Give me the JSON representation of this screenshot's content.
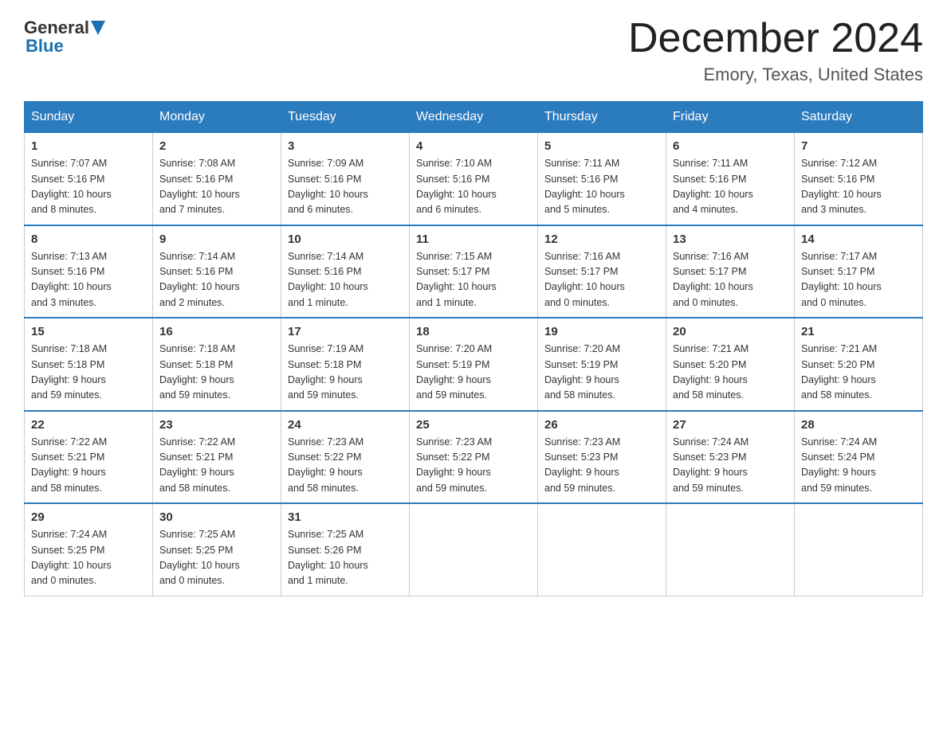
{
  "header": {
    "logo_general": "General",
    "logo_blue": "Blue",
    "month_year": "December 2024",
    "location": "Emory, Texas, United States"
  },
  "days_of_week": [
    "Sunday",
    "Monday",
    "Tuesday",
    "Wednesday",
    "Thursday",
    "Friday",
    "Saturday"
  ],
  "weeks": [
    [
      {
        "num": "1",
        "sunrise": "7:07 AM",
        "sunset": "5:16 PM",
        "daylight": "10 hours and 8 minutes."
      },
      {
        "num": "2",
        "sunrise": "7:08 AM",
        "sunset": "5:16 PM",
        "daylight": "10 hours and 7 minutes."
      },
      {
        "num": "3",
        "sunrise": "7:09 AM",
        "sunset": "5:16 PM",
        "daylight": "10 hours and 6 minutes."
      },
      {
        "num": "4",
        "sunrise": "7:10 AM",
        "sunset": "5:16 PM",
        "daylight": "10 hours and 6 minutes."
      },
      {
        "num": "5",
        "sunrise": "7:11 AM",
        "sunset": "5:16 PM",
        "daylight": "10 hours and 5 minutes."
      },
      {
        "num": "6",
        "sunrise": "7:11 AM",
        "sunset": "5:16 PM",
        "daylight": "10 hours and 4 minutes."
      },
      {
        "num": "7",
        "sunrise": "7:12 AM",
        "sunset": "5:16 PM",
        "daylight": "10 hours and 3 minutes."
      }
    ],
    [
      {
        "num": "8",
        "sunrise": "7:13 AM",
        "sunset": "5:16 PM",
        "daylight": "10 hours and 3 minutes."
      },
      {
        "num": "9",
        "sunrise": "7:14 AM",
        "sunset": "5:16 PM",
        "daylight": "10 hours and 2 minutes."
      },
      {
        "num": "10",
        "sunrise": "7:14 AM",
        "sunset": "5:16 PM",
        "daylight": "10 hours and 1 minute."
      },
      {
        "num": "11",
        "sunrise": "7:15 AM",
        "sunset": "5:17 PM",
        "daylight": "10 hours and 1 minute."
      },
      {
        "num": "12",
        "sunrise": "7:16 AM",
        "sunset": "5:17 PM",
        "daylight": "10 hours and 0 minutes."
      },
      {
        "num": "13",
        "sunrise": "7:16 AM",
        "sunset": "5:17 PM",
        "daylight": "10 hours and 0 minutes."
      },
      {
        "num": "14",
        "sunrise": "7:17 AM",
        "sunset": "5:17 PM",
        "daylight": "10 hours and 0 minutes."
      }
    ],
    [
      {
        "num": "15",
        "sunrise": "7:18 AM",
        "sunset": "5:18 PM",
        "daylight": "9 hours and 59 minutes."
      },
      {
        "num": "16",
        "sunrise": "7:18 AM",
        "sunset": "5:18 PM",
        "daylight": "9 hours and 59 minutes."
      },
      {
        "num": "17",
        "sunrise": "7:19 AM",
        "sunset": "5:18 PM",
        "daylight": "9 hours and 59 minutes."
      },
      {
        "num": "18",
        "sunrise": "7:20 AM",
        "sunset": "5:19 PM",
        "daylight": "9 hours and 59 minutes."
      },
      {
        "num": "19",
        "sunrise": "7:20 AM",
        "sunset": "5:19 PM",
        "daylight": "9 hours and 58 minutes."
      },
      {
        "num": "20",
        "sunrise": "7:21 AM",
        "sunset": "5:20 PM",
        "daylight": "9 hours and 58 minutes."
      },
      {
        "num": "21",
        "sunrise": "7:21 AM",
        "sunset": "5:20 PM",
        "daylight": "9 hours and 58 minutes."
      }
    ],
    [
      {
        "num": "22",
        "sunrise": "7:22 AM",
        "sunset": "5:21 PM",
        "daylight": "9 hours and 58 minutes."
      },
      {
        "num": "23",
        "sunrise": "7:22 AM",
        "sunset": "5:21 PM",
        "daylight": "9 hours and 58 minutes."
      },
      {
        "num": "24",
        "sunrise": "7:23 AM",
        "sunset": "5:22 PM",
        "daylight": "9 hours and 58 minutes."
      },
      {
        "num": "25",
        "sunrise": "7:23 AM",
        "sunset": "5:22 PM",
        "daylight": "9 hours and 59 minutes."
      },
      {
        "num": "26",
        "sunrise": "7:23 AM",
        "sunset": "5:23 PM",
        "daylight": "9 hours and 59 minutes."
      },
      {
        "num": "27",
        "sunrise": "7:24 AM",
        "sunset": "5:23 PM",
        "daylight": "9 hours and 59 minutes."
      },
      {
        "num": "28",
        "sunrise": "7:24 AM",
        "sunset": "5:24 PM",
        "daylight": "9 hours and 59 minutes."
      }
    ],
    [
      {
        "num": "29",
        "sunrise": "7:24 AM",
        "sunset": "5:25 PM",
        "daylight": "10 hours and 0 minutes."
      },
      {
        "num": "30",
        "sunrise": "7:25 AM",
        "sunset": "5:25 PM",
        "daylight": "10 hours and 0 minutes."
      },
      {
        "num": "31",
        "sunrise": "7:25 AM",
        "sunset": "5:26 PM",
        "daylight": "10 hours and 1 minute."
      },
      null,
      null,
      null,
      null
    ]
  ],
  "labels": {
    "sunrise": "Sunrise:",
    "sunset": "Sunset:",
    "daylight": "Daylight:"
  }
}
